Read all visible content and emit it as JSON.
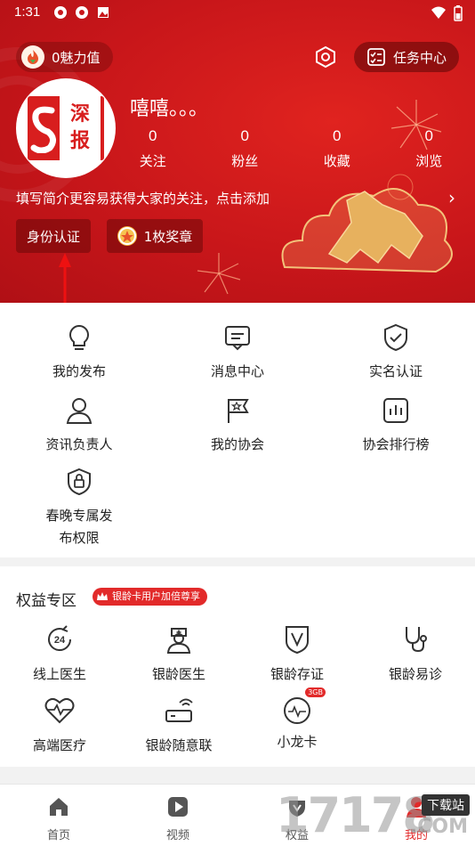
{
  "status_bar": {
    "time": "1:31"
  },
  "header": {
    "charm_label": "0魅力值",
    "task_center_label": "任务中心",
    "avatar_logo_text": [
      "深",
      "报"
    ],
    "username": "嘻嘻。。。",
    "stats": [
      {
        "value": "0",
        "label": "关注"
      },
      {
        "value": "0",
        "label": "粉丝"
      },
      {
        "value": "0",
        "label": "收藏"
      },
      {
        "value": "0",
        "label": "浏览"
      }
    ],
    "intro_text": "填写简介更容易获得大家的关注，点击添加",
    "id_verify_label": "身份认证",
    "medal_label": "1枚奖章"
  },
  "services": [
    {
      "label": "我的发布",
      "icon": "lightbulb-icon"
    },
    {
      "label": "消息中心",
      "icon": "message-icon"
    },
    {
      "label": "实名认证",
      "icon": "shield-check-icon"
    },
    {
      "label": "资讯负责人",
      "icon": "person-icon"
    },
    {
      "label": "我的协会",
      "icon": "flag-star-icon"
    },
    {
      "label": "协会排行榜",
      "icon": "bar-chart-icon"
    },
    {
      "label_line1": "春晚专属发",
      "label_line2": "布权限",
      "icon": "shield-lock-icon"
    }
  ],
  "rights": {
    "title": "权益专区",
    "tag": "银龄卡用户加倍尊享",
    "items": [
      {
        "label": "线上医生",
        "icon": "24h-icon"
      },
      {
        "label": "银龄医生",
        "icon": "doctor-icon"
      },
      {
        "label": "银龄存证",
        "icon": "certificate-shield-icon"
      },
      {
        "label": "银龄易诊",
        "icon": "stethoscope-icon"
      },
      {
        "label": "高端医疗",
        "icon": "heart-pulse-icon"
      },
      {
        "label": "银龄随意联",
        "icon": "router-icon"
      },
      {
        "label": "小龙卡",
        "icon": "sim-card-icon",
        "badge": "3GB"
      }
    ]
  },
  "bottom_nav": [
    {
      "label": "首页",
      "icon": "home-icon"
    },
    {
      "label": "视频",
      "icon": "play-icon"
    },
    {
      "label": "权益",
      "icon": "gift-icon"
    },
    {
      "label": "我的",
      "icon": "user-icon"
    }
  ],
  "watermark": {
    "number": "17178",
    "site": "下载站",
    "domain": ".COM"
  },
  "colors": {
    "brand_red": "#d81e1e",
    "header_red": "#c8161a",
    "accent_red": "#e22a2a"
  }
}
